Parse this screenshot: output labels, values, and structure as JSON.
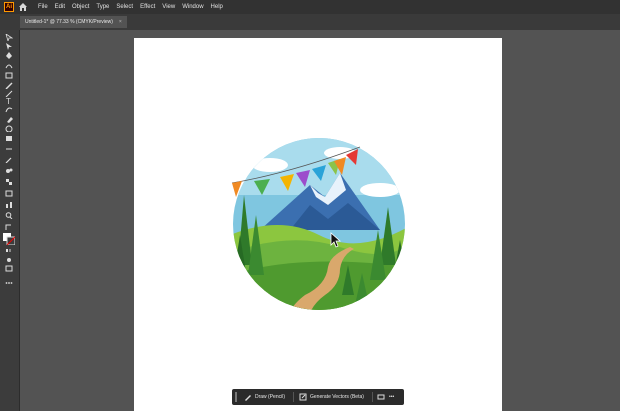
{
  "app": {
    "logo_text": "Ai"
  },
  "menu": [
    "File",
    "Edit",
    "Object",
    "Type",
    "Select",
    "Effect",
    "View",
    "Window",
    "Help"
  ],
  "document_tab": {
    "title": "Untitled-1* @ 77.33 % (CMYK/Preview)",
    "close": "×"
  },
  "contextual_bar": {
    "draw_label": "Draw (Pencil)",
    "generate_label": "Generate Vectors (Beta)",
    "more_label": "•••"
  },
  "colors": {
    "accent": "#ff9a00",
    "ui_bg": "#535353",
    "panel": "#323232"
  },
  "artwork": {
    "description_name": "mountain-landscape-badge"
  }
}
